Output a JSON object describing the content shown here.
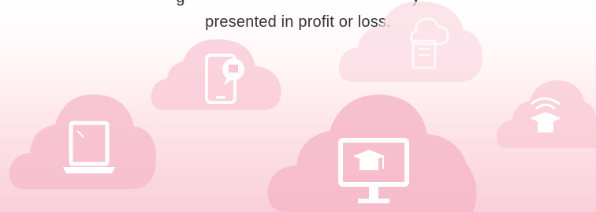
{
  "caption": {
    "partial_line": "g                                                  y",
    "main_line": "presented in profit or loss."
  },
  "colors": {
    "cloud_fill": "#f7c2d0",
    "cloud_fill_light": "#fbd8e2",
    "icon_fill": "#ffffff",
    "text": "#333333"
  },
  "icons": [
    "phone-chat-icon",
    "cloud-document-icon",
    "wifi-graduation-icon",
    "laptop-icon",
    "monitor-graduation-icon"
  ]
}
